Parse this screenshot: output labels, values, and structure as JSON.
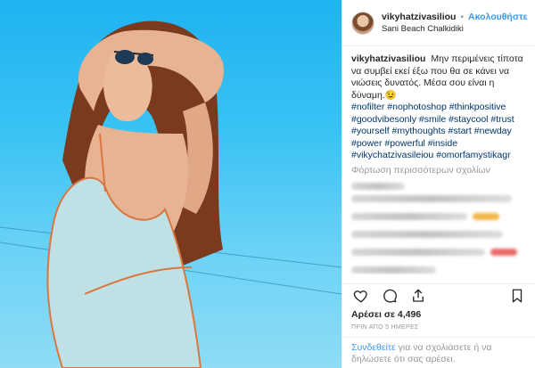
{
  "post": {
    "username": "vikyhatzivasiliou",
    "separator": "•",
    "follow_label": "Ακολουθήστε",
    "location": "Sani Beach Chalkidiki"
  },
  "caption": {
    "username": "vikyhatzivasiliou",
    "text": "Μην περιμένεις τίποτα να συμβεί εκεί έξω που θα σε κάνει να νιώσεις δυνατός. Μέσα σου είναι η δύναμη.😉",
    "hashtags": [
      "#nofilter #nophotoshop #thinkpositive",
      "#goodvibesonly #smile #staycool #trust",
      "#yourself #mythoughts #start #newday",
      "#power #powerful #inside",
      "#vikychatzivasileiou #omorfamystikagr"
    ]
  },
  "load_more_label": "Φόρτωση περισσότερων σχολίων",
  "likes": "Αρέσει σε 4,496",
  "time_ago": "ΠΡΙΝ ΑΠΟ 5 ΗΜΕΡΕΣ",
  "login": {
    "link": "Συνδεθείτε",
    "text": " για να σχολιάσετε ή να δηλώσετε ότι σας αρέσει."
  },
  "icons": {
    "like": "heart-icon",
    "comment": "comment-icon",
    "share": "share-icon",
    "save": "bookmark-icon"
  },
  "colors": {
    "accent": "#3897f0",
    "hashtag": "#003569",
    "muted": "#999999",
    "sky": "#2ab8f2"
  }
}
